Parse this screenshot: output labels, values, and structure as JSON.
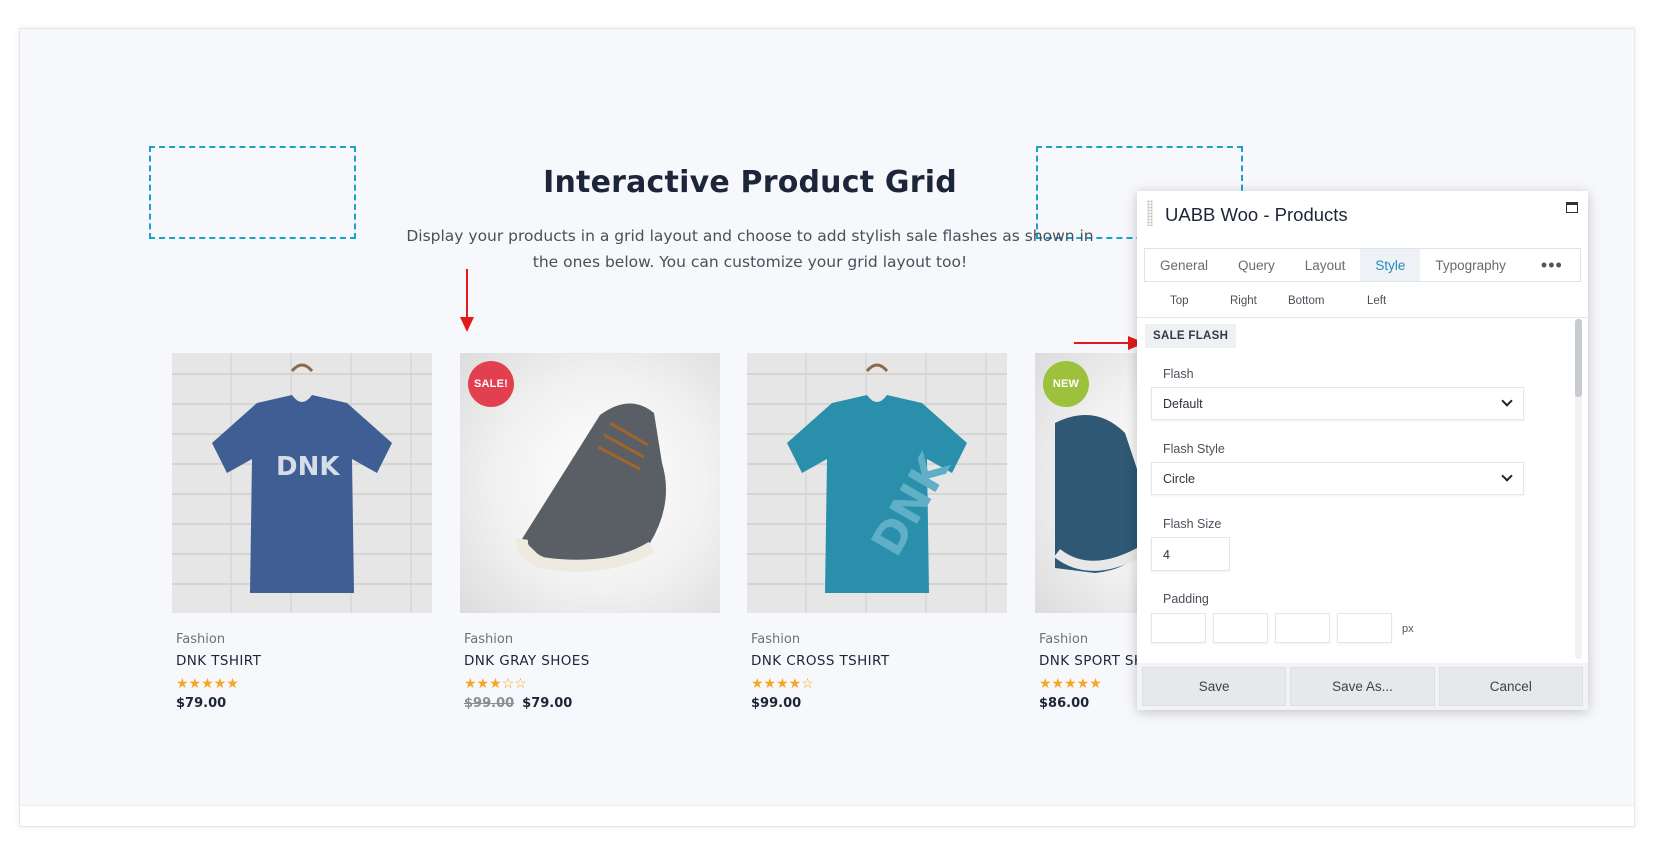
{
  "page": {
    "heading": "Interactive Product Grid",
    "subheading": "Display your products in a grid layout and choose to add stylish sale flashes as shown in the ones below. You can customize your grid layout too!"
  },
  "products": [
    {
      "category": "Fashion",
      "title": "DNK TSHIRT",
      "rating": 5,
      "stars": "★★★★★",
      "price": "$79.00",
      "old_price": "",
      "badge": "",
      "badge_color": ""
    },
    {
      "category": "Fashion",
      "title": "DNK GRAY SHOES",
      "rating": 3,
      "stars": "★★★☆☆",
      "price": "$79.00",
      "old_price": "$99.00",
      "badge": "SALE!",
      "badge_color": "#e2404f"
    },
    {
      "category": "Fashion",
      "title": "DNK CROSS TSHIRT",
      "rating": 4,
      "stars": "★★★★☆",
      "price": "$99.00",
      "old_price": "",
      "badge": "",
      "badge_color": ""
    },
    {
      "category": "Fashion",
      "title": "DNK SPORT SH",
      "rating": 5,
      "stars": "★★★★★",
      "price": "$86.00",
      "old_price": "",
      "badge": "NEW",
      "badge_color": "#9ec13d"
    }
  ],
  "panel": {
    "title": "UABB Woo - Products",
    "tabs": [
      "General",
      "Query",
      "Layout",
      "Style",
      "Typography"
    ],
    "active_tab": "Style",
    "more_label": "•••",
    "sides": [
      "Top",
      "Right",
      "Bottom",
      "Left"
    ],
    "section_label": "SALE FLASH",
    "flash_label": "Flash",
    "flash_value": "Default",
    "flash_style_label": "Flash Style",
    "flash_style_value": "Circle",
    "flash_size_label": "Flash Size",
    "flash_size_value": "4",
    "padding_label": "Padding",
    "padding_unit": "px",
    "buttons": {
      "save": "Save",
      "save_as": "Save As...",
      "cancel": "Cancel"
    }
  },
  "colors": {
    "accent": "#1e8cbe",
    "dashed_outline": "#1aa3c9",
    "arrow": "#e01b1b",
    "star": "#f5a623"
  }
}
